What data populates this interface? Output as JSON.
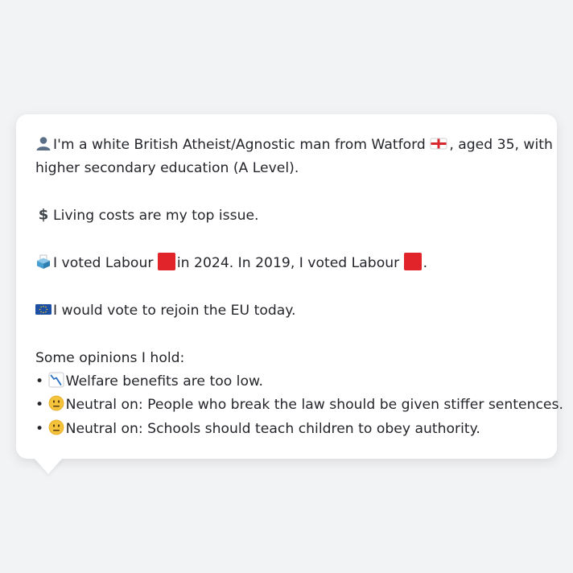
{
  "profile": {
    "intro_line1": "I'm a white British Atheist/Agnostic man from Watford",
    "intro_line1_end": ", aged 35, with",
    "intro_line2": "higher secondary education (A Level).",
    "top_issue": "Living costs are my top issue.",
    "vote_part1": "I voted Labour",
    "vote_part2": "in 2024. In 2019, I voted Labour",
    "vote_part3": ".",
    "eu_stance": "I would vote to rejoin the EU today.",
    "opinions_heading": "Some opinions I hold:",
    "opinions": [
      "Welfare benefits are too low.",
      "Neutral on: People who break the law should be given stiffer sentences.",
      "Neutral on: Schools should teach children to obey authority."
    ],
    "bullet": "•"
  },
  "icons": {
    "person": "bust-silhouette-icon",
    "england_flag": "england-flag-icon",
    "money": "dollar-sign-icon",
    "ballot": "ballot-box-icon",
    "labour": "red-square-icon",
    "eu": "eu-flag-icon",
    "down": "chart-decreasing-icon",
    "neutral": "neutral-face-icon"
  },
  "colors": {
    "labour_red": "#e0242a",
    "eu_blue": "#1d4fa3",
    "eu_star": "#f5cc21",
    "text": "#24262b",
    "card_bg": "#ffffff",
    "page_bg": "#f2f3f5"
  }
}
